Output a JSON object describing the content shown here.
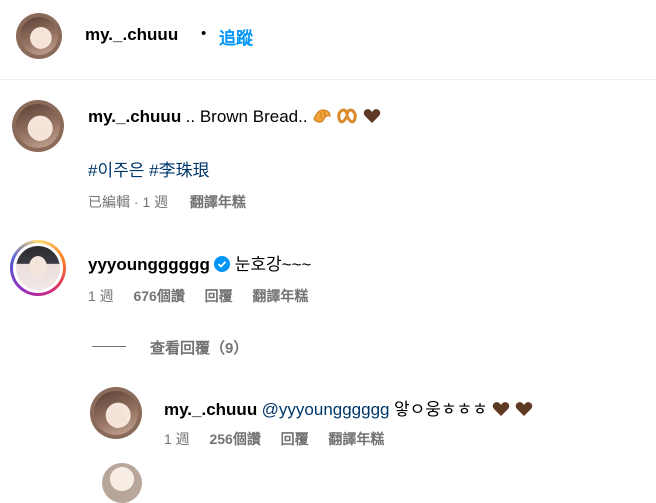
{
  "header": {
    "username": "my._.chuuu",
    "dot": "•",
    "follow_label": "追蹤"
  },
  "caption": {
    "username": "my._.chuuu",
    "text": ".. Brown Bread..",
    "emoji": [
      "croissant-icon",
      "pretzel-icon",
      "brown-heart-icon"
    ],
    "hashtags": [
      "#이주은",
      "#李珠珢"
    ],
    "edited_label": "已編輯",
    "sep": "·",
    "time": "1 週",
    "translate_label": "翻譯年糕"
  },
  "comments": [
    {
      "username": "yyyoungggggg",
      "verified": true,
      "text": "눈호강~~~",
      "time": "1 週",
      "likes": "676個讚",
      "reply_label": "回覆",
      "translate_label": "翻譯年糕",
      "view_replies": "查看回覆（9）"
    }
  ],
  "reply": {
    "username": "my._.chuuu",
    "mention": "@yyyoungggggg",
    "text": "앟ㅇ웅ㅎㅎㅎ",
    "emoji": [
      "brown-heart-icon",
      "brown-heart-icon"
    ],
    "time": "1 週",
    "likes": "256個讚",
    "reply_label": "回覆",
    "translate_label": "翻譯年糕"
  },
  "colors": {
    "link": "#00376b",
    "accent": "#0095f6",
    "muted": "#737373",
    "divider": "#efefef"
  }
}
